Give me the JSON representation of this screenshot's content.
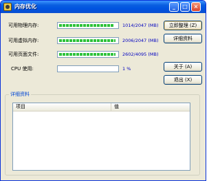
{
  "window": {
    "title": "内存优化",
    "icon": "memory-app-icon",
    "caption_buttons": {
      "minimize": "_",
      "maximize": "□",
      "close": "×"
    }
  },
  "metrics": [
    {
      "label": "可用物理内存:",
      "value": "1014/2047 (MB)",
      "fill_fraction": 0.95
    },
    {
      "label": "可用虚拟内存:",
      "value": "2006/2047 (MB)",
      "fill_fraction": 0.98
    },
    {
      "label": "可用页面文件:",
      "value": "2602/4095 (MB)",
      "fill_fraction": 0.98
    },
    {
      "label": "CPU 使用:",
      "value": "1 %",
      "fill_fraction": 0.0
    }
  ],
  "buttons": {
    "optimize": "立即整理 (Z)",
    "details": "详细资料",
    "about": "关于 (A)",
    "exit": "退出 (X)"
  },
  "details_group": {
    "title": "详细资料",
    "columns": [
      "项目",
      "值"
    ],
    "rows": []
  },
  "colors": {
    "title_bar": "#0a5fe0",
    "window_bg": "#ece9d8",
    "bar_fill": "#2ec23a",
    "value_text": "#0000c0",
    "group_title": "#0046d5"
  }
}
